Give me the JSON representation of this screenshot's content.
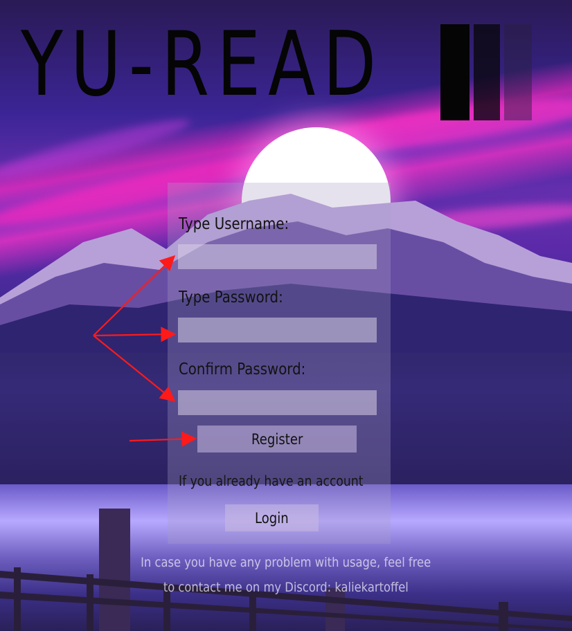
{
  "header": {
    "title": "YU-READ"
  },
  "form": {
    "username_label": "Type Username:",
    "username_value": "",
    "password_label": "Type Password:",
    "password_value": "",
    "confirm_label": "Confirm Password:",
    "confirm_value": "",
    "register_label": "Register",
    "account_text": "If you already have an account",
    "login_label": "Login"
  },
  "footer": {
    "line1": "In case you have any problem with usage, feel free",
    "line2": "to contact me on my Discord: kaliekartoffel"
  },
  "colors": {
    "annotation_arrow": "#ff1a1a",
    "accent_pink": "#ff3cc8",
    "title": "#050505"
  }
}
